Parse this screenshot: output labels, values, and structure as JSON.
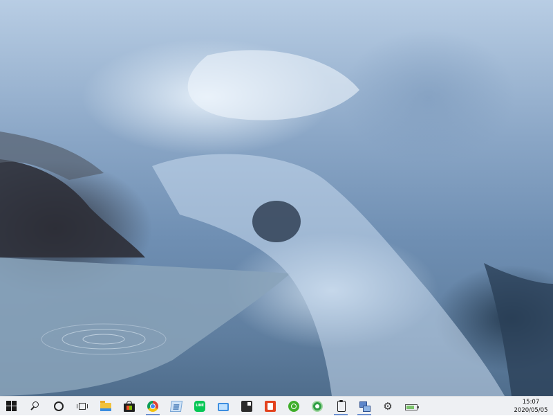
{
  "desktop": {
    "wallpaper": "ice-cave-photo"
  },
  "taskbar": {
    "background": "#eef0f3",
    "accent": "#6b8fcf",
    "items": [
      {
        "name": "start-button",
        "icon": "windows-logo-icon",
        "running": false
      },
      {
        "name": "search-button",
        "icon": "search-icon",
        "running": false
      },
      {
        "name": "cortana-button",
        "icon": "cortana-circle-icon",
        "running": false
      },
      {
        "name": "task-view-button",
        "icon": "task-view-icon",
        "running": false
      },
      {
        "name": "file-explorer-button",
        "icon": "folder-icon",
        "running": false
      },
      {
        "name": "microsoft-store-button",
        "icon": "store-bag-icon",
        "running": false
      },
      {
        "name": "chrome-button",
        "icon": "chrome-icon",
        "running": true
      },
      {
        "name": "notes-app-button",
        "icon": "document-icon",
        "running": false
      },
      {
        "name": "line-app-button",
        "icon": "line-chat-icon",
        "running": false
      },
      {
        "name": "remote-desktop-button",
        "icon": "remote-desktop-icon",
        "running": false
      },
      {
        "name": "sticky-notes-button",
        "icon": "sticky-note-icon",
        "running": false
      },
      {
        "name": "office-button",
        "icon": "office-icon",
        "running": false
      },
      {
        "name": "green-app-button",
        "icon": "green-circle-icon",
        "running": false
      },
      {
        "name": "green-app-2-button",
        "icon": "green-ring-icon",
        "running": false
      },
      {
        "name": "clipboard-button",
        "icon": "clipboard-icon",
        "running": true
      },
      {
        "name": "network-app-button",
        "icon": "network-icon",
        "running": true
      },
      {
        "name": "settings-button",
        "icon": "gear-icon",
        "running": false
      },
      {
        "name": "battery-app-button",
        "icon": "battery-icon",
        "running": false
      }
    ],
    "clock": {
      "time": "15:07",
      "date": "2020/05/05"
    }
  }
}
